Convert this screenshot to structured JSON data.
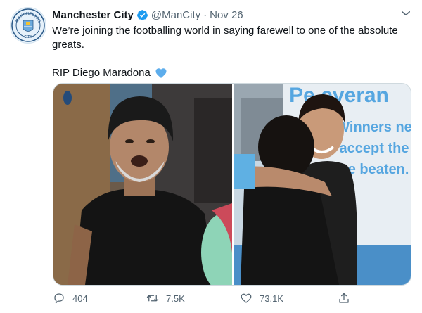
{
  "tweet": {
    "display_name": "Manchester City",
    "handle": "@ManCity",
    "separator": "·",
    "timestamp": "Nov 26",
    "text_line1": "We’re joining the footballing world in saying farewell to one of the absolute greats.",
    "text_line2": "RIP Diego Maradona",
    "heart_emoji": "blue-heart-icon",
    "avatar_badge_text": "MANCHESTER CITY",
    "media": {
      "photo_right_sign_text": [
        "Pe   everan",
        "Winners ne",
        "accept the",
        "be beaten."
      ]
    },
    "stats": {
      "replies": "404",
      "retweets": "7.5K",
      "likes": "73.1K"
    }
  },
  "colors": {
    "verified_blue": "#1d9bf0",
    "secondary_text": "#536471",
    "city_blue": "#6cabdd"
  }
}
